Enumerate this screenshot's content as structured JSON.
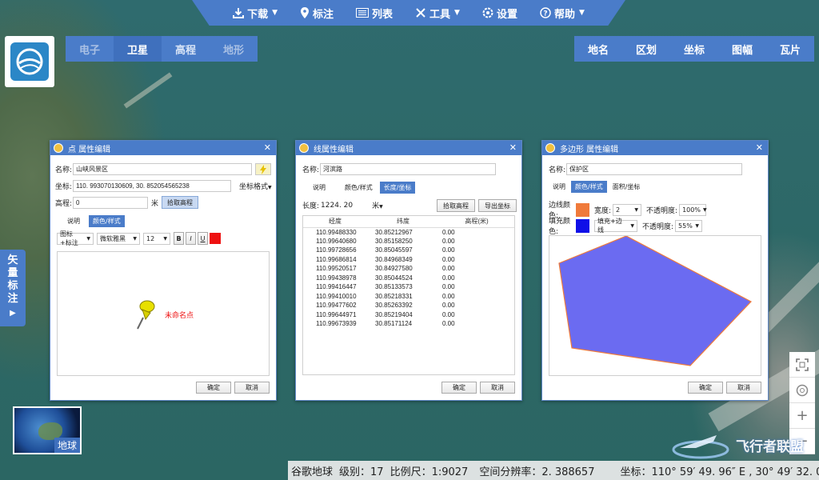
{
  "toolbar": {
    "download": "下载",
    "mark": "标注",
    "list": "列表",
    "tools": "工具",
    "settings": "设置",
    "help": "帮助"
  },
  "maptypes": [
    "电子",
    "卫星",
    "高程",
    "地形"
  ],
  "maptype_active": "卫星",
  "right_tabs": [
    "地名",
    "区划",
    "坐标",
    "图幅",
    "瓦片"
  ],
  "side_tab": [
    "矢",
    "量",
    "标",
    "注"
  ],
  "globe_label": "地球",
  "status": {
    "source": "谷歌地球",
    "level": "级别：17",
    "scale": "比例尺：1:9027",
    "resolution": "空间分辨率：2. 388657",
    "coord": "坐标：110° 59′ 49. 96″ E , 30° 49′ 32. 00″ N"
  },
  "watermark": "飞行者联盟",
  "point_dialog": {
    "title": "点 属性编辑",
    "name_label": "名称:",
    "name_value": "山峡风景区",
    "coord_label": "坐标:",
    "coord_value": "110. 993070130609, 30. 852054565238",
    "coord_format": "坐标格式",
    "elev_label": "高程:",
    "elev_value": "0",
    "elev_unit": "米",
    "pick_elev": "拾取高程",
    "tab_desc": "说明",
    "tab_style": "颜色/样式",
    "icon_label": "图标+标注",
    "font": "微软雅黑",
    "size": "12",
    "bold": "B",
    "italic": "I",
    "underline": "U",
    "preview_label": "未命名点",
    "ok": "确定",
    "cancel": "取消"
  },
  "line_dialog": {
    "title": "线属性编辑",
    "name_label": "名称:",
    "name_value": "河滨路",
    "tab_desc": "说明",
    "tab_style": "颜色/样式",
    "tab_len": "长度/坐标",
    "len_label": "长度:",
    "len_value": "1224. 20",
    "len_unit": "米",
    "pick_elev": "拾取高程",
    "export": "导出坐标",
    "headers": [
      "经度",
      "纬度",
      "高程(米)"
    ],
    "rows": [
      [
        "110.99488330",
        "30.85212967",
        "0.00"
      ],
      [
        "110.99640680",
        "30.85158250",
        "0.00"
      ],
      [
        "110.99728656",
        "30.85045597",
        "0.00"
      ],
      [
        "110.99686814",
        "30.84968349",
        "0.00"
      ],
      [
        "110.99520517",
        "30.84927580",
        "0.00"
      ],
      [
        "110.99438978",
        "30.85044524",
        "0.00"
      ],
      [
        "110.99416447",
        "30.85133573",
        "0.00"
      ],
      [
        "110.99410010",
        "30.85218331",
        "0.00"
      ],
      [
        "110.99477602",
        "30.85263392",
        "0.00"
      ],
      [
        "110.99644971",
        "30.85219404",
        "0.00"
      ],
      [
        "110.99673939",
        "30.85171124",
        "0.00"
      ]
    ],
    "ok": "确定",
    "cancel": "取消"
  },
  "poly_dialog": {
    "title": "多边形 属性编辑",
    "name_label": "名称:",
    "name_value": "保护区",
    "tab_desc": "说明",
    "tab_style": "颜色/样式",
    "tab_area": "面积/坐标",
    "border_color_label": "边线颜色:",
    "fill_color_label": "填充颜色:",
    "width_label": "宽度:",
    "width_value": "2",
    "fill_mode": "填充+边线",
    "opacity_label": "不透明度:",
    "opacity1": "100%",
    "opacity2": "55%",
    "border_color": "#f07a3a",
    "fill_color": "#1010e8",
    "ok": "确定",
    "cancel": "取消"
  }
}
